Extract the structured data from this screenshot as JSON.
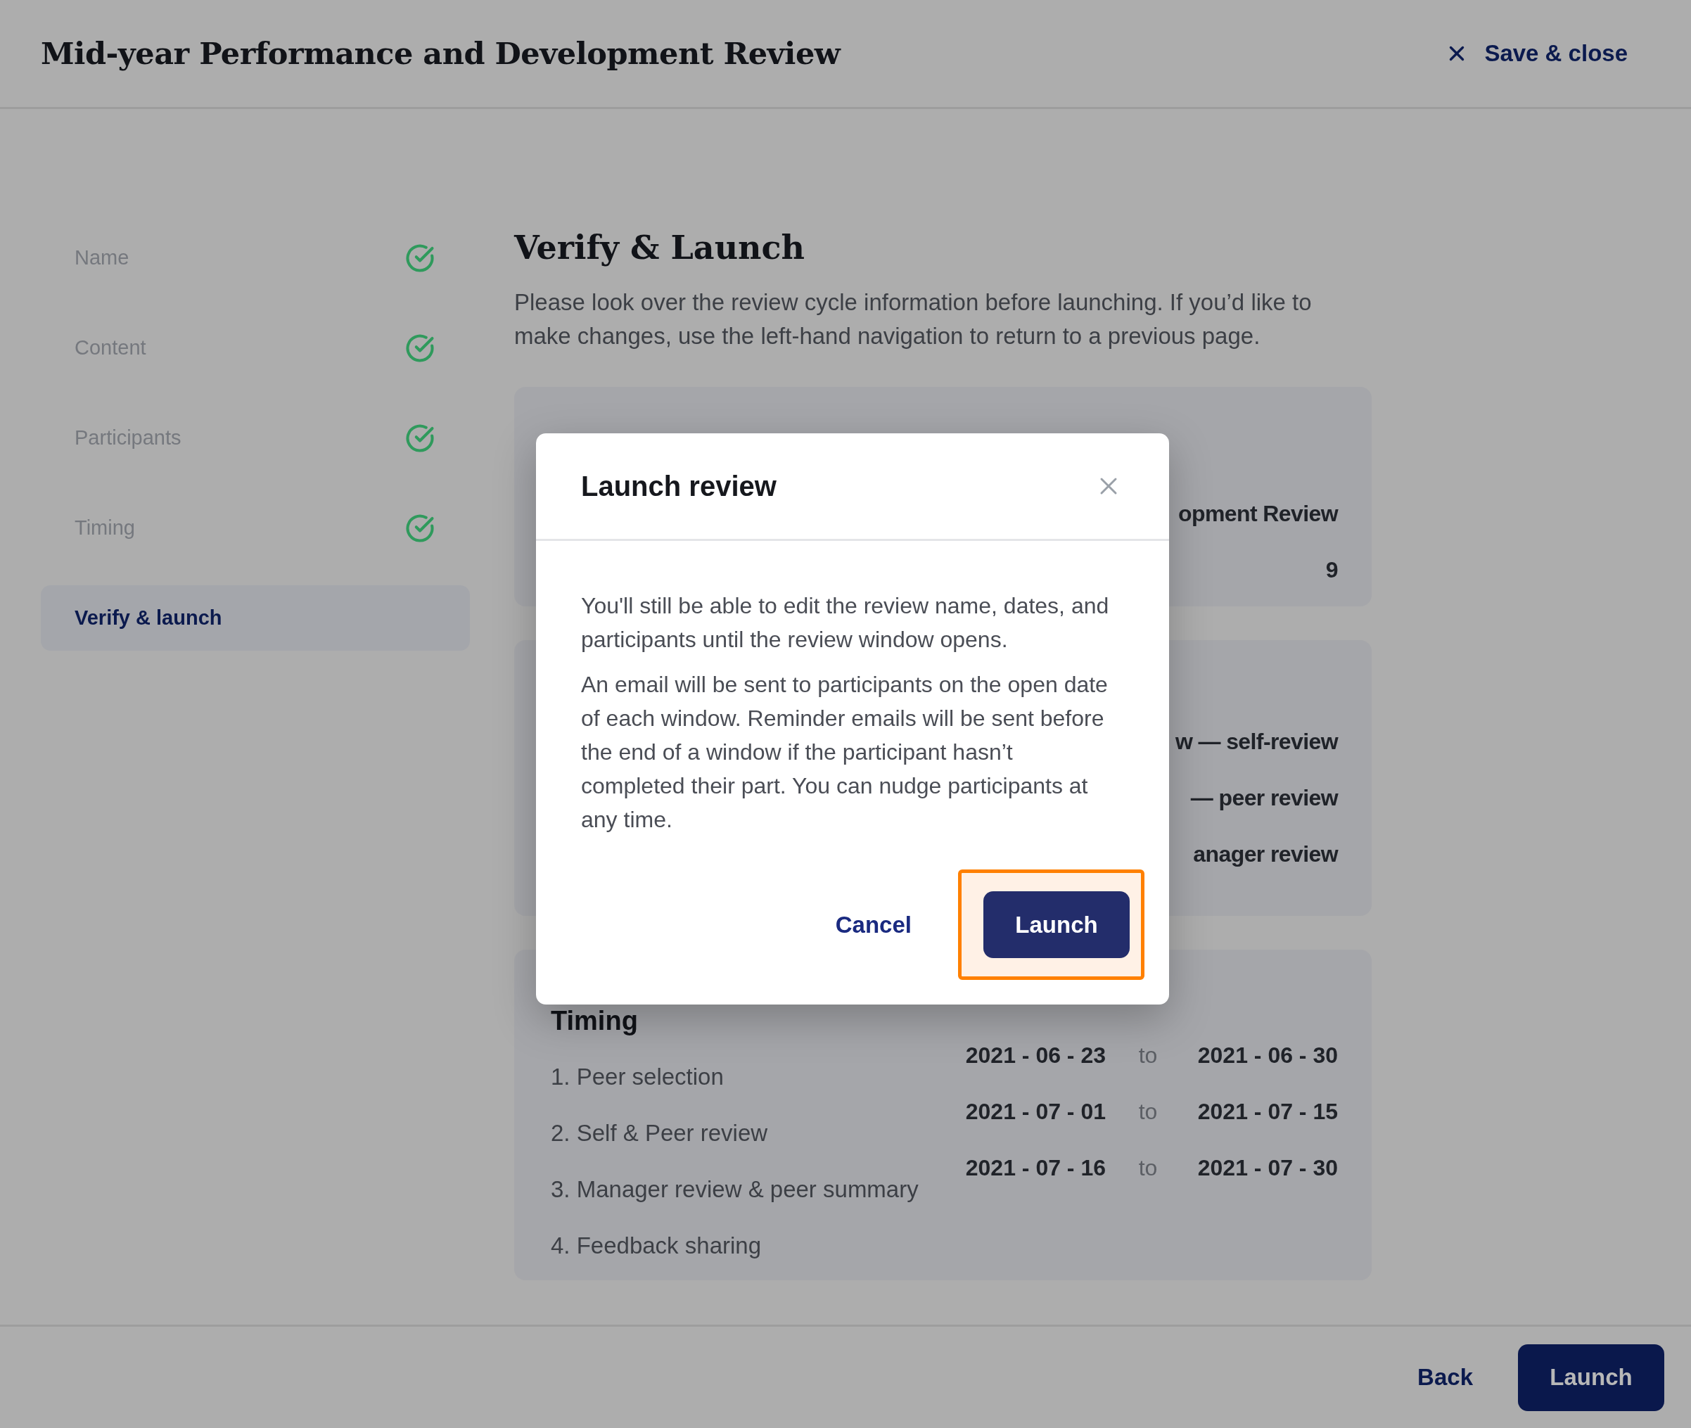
{
  "header": {
    "title": "Mid-year Performance and Development Review",
    "close_label": "Save & close"
  },
  "steps": [
    {
      "label": "Name",
      "completed": true,
      "selected": false
    },
    {
      "label": "Content",
      "completed": true,
      "selected": false
    },
    {
      "label": "Participants",
      "completed": true,
      "selected": false
    },
    {
      "label": "Timing",
      "completed": true,
      "selected": false
    },
    {
      "label": "Verify & launch",
      "completed": false,
      "selected": true
    }
  ],
  "page": {
    "heading": "Verify & Launch",
    "intro": "Please look over the review cycle information before launching. If you’d like to make changes, use the left-hand navigation to return to a previous page."
  },
  "summary_cards": [
    {
      "rows": [
        "opment Review",
        "9"
      ]
    },
    {
      "rows": [
        "w — self-review",
        "— peer review",
        "anager review"
      ]
    }
  ],
  "timing": {
    "heading": "Timing",
    "phases": [
      {
        "label": "1. Peer selection",
        "start": "2021 - 06 - 23",
        "separator": "to",
        "end": "2021 - 06 - 30"
      },
      {
        "label": "2. Self & Peer review",
        "start": "2021 - 07 - 01",
        "separator": "to",
        "end": "2021 - 07 - 15"
      },
      {
        "label": "3. Manager review & peer summary",
        "start": "2021 - 07 - 16",
        "separator": "to",
        "end": "2021 - 07 - 30"
      },
      {
        "label": "4. Feedback sharing"
      }
    ]
  },
  "footer": {
    "buttons": [
      {
        "label": "Back",
        "kind": "link"
      },
      {
        "label": "Launch",
        "kind": "primary"
      }
    ]
  },
  "modal": {
    "title": "Launch review",
    "paragraphs": [
      "You'll still be able to edit the review name, dates, and participants until the review window opens.",
      "An email will be sent to participants on the open date of each window. Reminder emails will be sent before the end of a window if the participant hasn’t completed their part. You can nudge participants at any time."
    ],
    "buttons": [
      {
        "label": "Cancel",
        "kind": "link",
        "highlighted": false
      },
      {
        "label": "Launch",
        "kind": "primary",
        "highlighted": true
      }
    ]
  }
}
